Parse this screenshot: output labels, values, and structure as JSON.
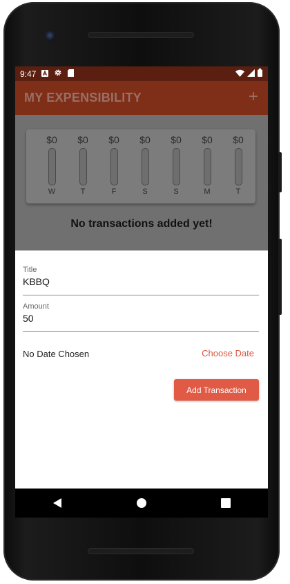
{
  "status_bar": {
    "time": "9:47",
    "icons": [
      "a-notification-icon",
      "gear-icon",
      "sd-card-icon"
    ],
    "right_icons": [
      "wifi-icon",
      "signal-icon",
      "battery-icon"
    ]
  },
  "app_bar": {
    "title": "MY EXPENSIBILITY",
    "add_icon": "+"
  },
  "chart": {
    "bars": [
      {
        "amount": "$0",
        "day": "W",
        "fill": 0
      },
      {
        "amount": "$0",
        "day": "T",
        "fill": 0
      },
      {
        "amount": "$0",
        "day": "F",
        "fill": 0
      },
      {
        "amount": "$0",
        "day": "S",
        "fill": 0
      },
      {
        "amount": "$0",
        "day": "S",
        "fill": 0
      },
      {
        "amount": "$0",
        "day": "M",
        "fill": 0
      },
      {
        "amount": "$0",
        "day": "T",
        "fill": 0
      }
    ]
  },
  "empty_message": "No transactions added yet!",
  "form": {
    "title_label": "Title",
    "title_value": "KBBQ",
    "amount_label": "Amount",
    "amount_value": "50",
    "date_text": "No Date Chosen",
    "choose_date_label": "Choose Date",
    "submit_label": "Add Transaction"
  },
  "nav": {
    "back": "back-icon",
    "home": "home-icon",
    "recents": "recents-icon"
  },
  "colors": {
    "status_bar": "#5a1f10",
    "app_bar": "#7f2e18",
    "accent": "#e05a45"
  }
}
